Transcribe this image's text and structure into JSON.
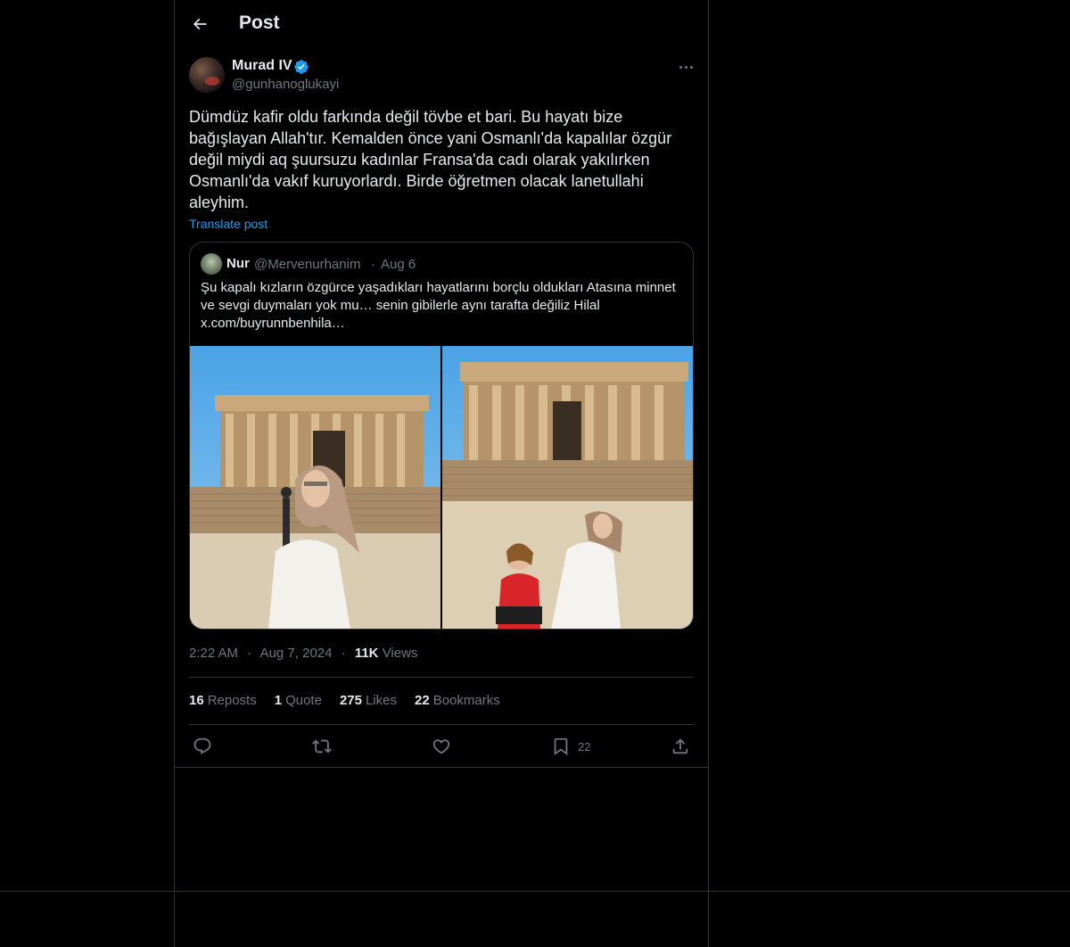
{
  "header": {
    "title": "Post",
    "back_icon": "arrow-left-icon"
  },
  "author": {
    "name": "Murad IV",
    "handle": "@gunhanoglukayi",
    "verified": true,
    "verified_color": "#1d9bf0"
  },
  "post": {
    "text": "Dümdüz kafir oldu farkında değil tövbe et bari. Bu hayatı bize bağışlayan Allah'tır. Kemalden önce yani Osmanlı'da kapalılar özgür değil miydi aq şuursuzu kadınlar Fransa'da cadı olarak yakılırken Osmanlı'da vakıf kuruyorlardı. Birde öğretmen olacak lanetullahi aleyhim.",
    "translate_label": "Translate post"
  },
  "quote": {
    "name": "Nur",
    "handle": "@Mervenurhanim",
    "separator": "·",
    "date": "Aug 6",
    "text": "Şu kapalı kızların özgürce yaşadıkları hayatlarını borçlu oldukları Atasına minnet ve sevgi duymaları yok mu… senin gibilerle aynı tarafta değiliz Hilal x.com/buyrunnbenhila…"
  },
  "meta": {
    "time": "2:22 AM",
    "sep1": "·",
    "date": "Aug 7, 2024",
    "sep2": "·",
    "views_count": "11K",
    "views_label": "Views"
  },
  "stats": [
    {
      "num": "16",
      "label": "Reposts"
    },
    {
      "num": "1",
      "label": "Quote"
    },
    {
      "num": "275",
      "label": "Likes"
    },
    {
      "num": "22",
      "label": "Bookmarks"
    }
  ],
  "actions": {
    "reply_icon": "reply-icon",
    "repost_icon": "repost-icon",
    "like_icon": "like-icon",
    "bookmark_icon": "bookmark-icon",
    "bookmark_count": "22",
    "share_icon": "share-icon"
  },
  "colors": {
    "background": "#000000",
    "text": "#e7e9ea",
    "muted": "#71767b",
    "border": "#2f3336",
    "accent": "#1d9bf0"
  }
}
